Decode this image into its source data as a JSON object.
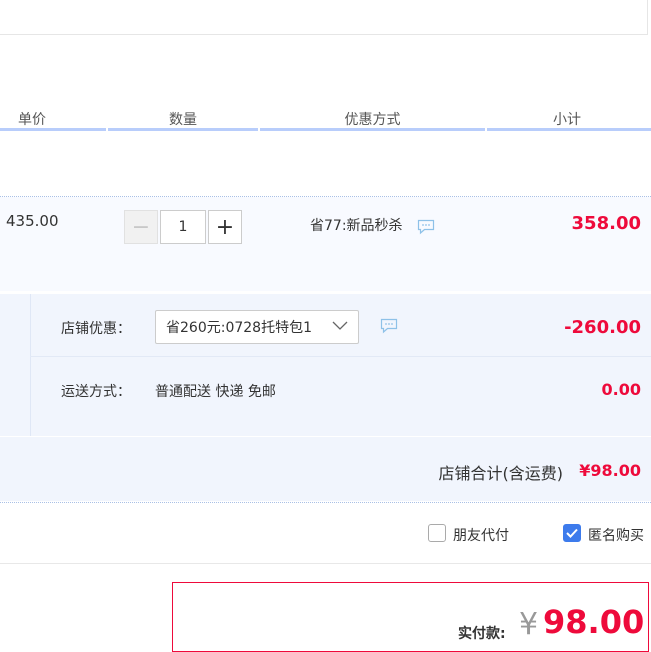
{
  "header": {
    "price_label": "单价",
    "quantity_label": "数量",
    "discount_label": "优惠方式",
    "subtotal_label": "小计"
  },
  "item": {
    "unit_price": "435.00",
    "quantity": "1",
    "minus_label": "−",
    "plus_label": "+",
    "discount_text": "省77:新品秒杀",
    "subtotal": "358.00"
  },
  "shop": {
    "discount_label": "店铺优惠：",
    "discount_selected": "省260元:0728托特包1",
    "discount_amount": "-260.00",
    "shipping_label": "运送方式：",
    "shipping_value": "普通配送 快递 免邮",
    "shipping_fee": "0.00",
    "total_label": "店铺合计(含运费)",
    "total_value": "¥98.00"
  },
  "options": {
    "friend_pay_label": "朋友代付",
    "friend_pay_checked": false,
    "anonymous_label": "匿名购买",
    "anonymous_checked": true
  },
  "payment": {
    "label": "实付款:",
    "currency": "¥",
    "amount": "98.00"
  },
  "colors": {
    "accent_red": "#ee0a3b",
    "header_line": "#b8cdfb",
    "checkbox_blue": "#3d7bec"
  },
  "icons": {
    "message": "chat-bubble-icon",
    "dropdown": "chevron-down-icon",
    "check": "checkmark-icon"
  }
}
